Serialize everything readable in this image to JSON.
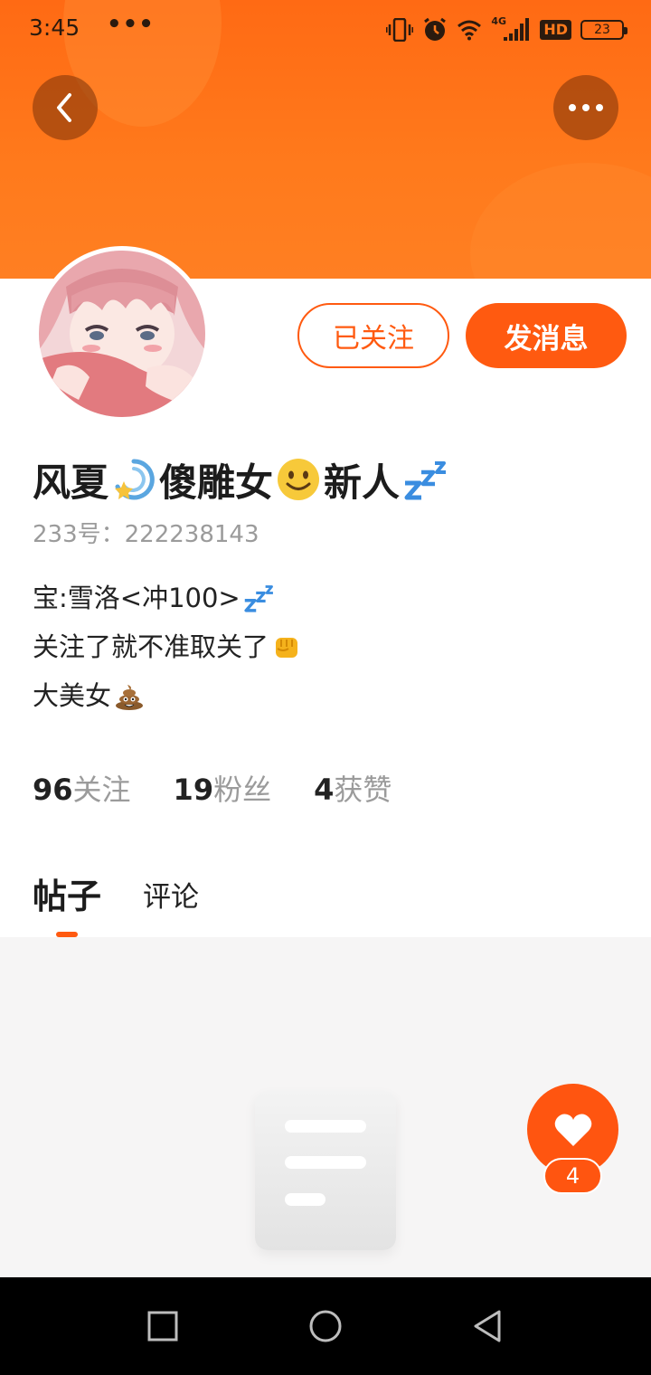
{
  "status_bar": {
    "time": "3:45",
    "overflow_dots": "•••",
    "network_label": "4G",
    "hd_label": "HD",
    "battery_level": "23"
  },
  "header": {
    "back_icon": "chevron-left-icon",
    "more_icon": "more-horizontal-icon",
    "banner_color": "#ff6a14"
  },
  "profile": {
    "follow_button_label": "已关注",
    "message_button_label": "发消息",
    "nickname_parts": [
      "风夏",
      "傻雕女",
      "新人"
    ],
    "user_id": "233号：222238143",
    "bio_lines": [
      "宝:雪洛<冲100>",
      "关注了就不准取关了",
      "大美女"
    ]
  },
  "stats": [
    {
      "value": "96",
      "label": "关注"
    },
    {
      "value": "19",
      "label": "粉丝"
    },
    {
      "value": "4",
      "label": "获赞"
    }
  ],
  "tabs": [
    {
      "label": "帖子",
      "active": true
    },
    {
      "label": "评论",
      "active": false
    }
  ],
  "like_fab": {
    "icon": "heart-icon",
    "count": "4"
  },
  "accent_color": "#ff5a10",
  "nav_bar": {
    "icons": [
      "recent-apps-icon",
      "home-icon",
      "back-triangle-icon"
    ]
  }
}
